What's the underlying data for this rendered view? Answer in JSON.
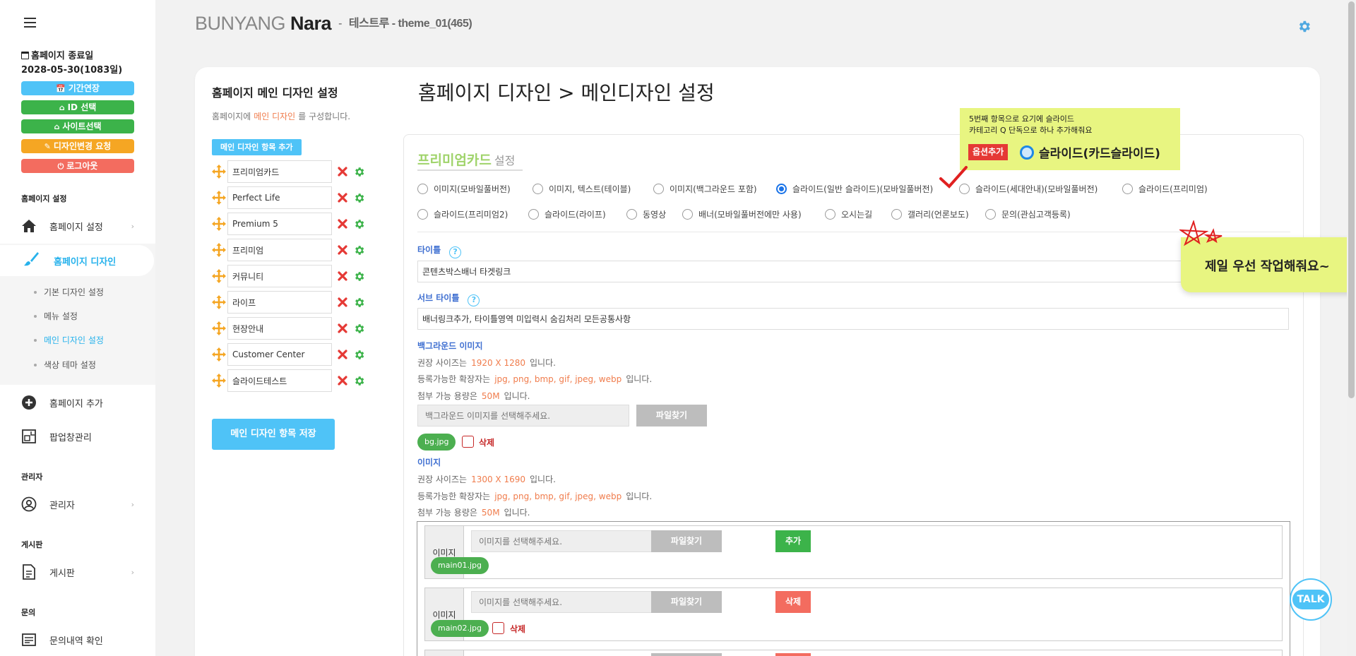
{
  "colors": {
    "accent": "#27b2ec",
    "green": "#4caf50",
    "red": "#e53935",
    "note": "#e8f581"
  },
  "sidebar": {
    "expiry_title": "홈페이지 종료일",
    "expiry_date": "2028-05-30(1083일)",
    "buttons": [
      {
        "label": "기간연장",
        "icon": "calendar-icon",
        "color": "#4fc3f7"
      },
      {
        "label": "ID 선택",
        "icon": "home-icon",
        "color": "#3cb34a"
      },
      {
        "label": "사이트선택",
        "icon": "home-icon",
        "color": "#3cb34a"
      },
      {
        "label": "디자인변경 요청",
        "icon": "brush-icon",
        "color": "#f5a623"
      },
      {
        "label": "로그아웃",
        "icon": "power-icon",
        "color": "#f36c5f"
      }
    ],
    "sections": {
      "homepage_settings": "홈페이지 설정",
      "admin": "관리자",
      "board": "게시판",
      "inquiry": "문의"
    },
    "nav": {
      "homepage_settings": "홈페이지 설정",
      "homepage_design": "홈페이지 디자인",
      "add_homepage": "홈페이지 추가",
      "popup": "팝업창관리",
      "admin": "관리자",
      "board": "게시판",
      "inquiry_check": "문의내역 확인"
    },
    "sub_items": [
      "기본 디자인 설정",
      "메뉴 설정",
      "메인 디자인 설정",
      "색상 테마 설정"
    ],
    "active_sub": "메인 디자인 설정"
  },
  "header": {
    "brand_light": "BUNYANG ",
    "brand_bold": "Nara",
    "separator": "-",
    "project": "테스트루 - theme_01(465)"
  },
  "left_panel": {
    "title": "홈페이지 메인 디자인 설정",
    "desc_prefix": "홈페이지에",
    "desc_highlight": "메인 디자인",
    "desc_suffix": "를 구성합니다.",
    "add_button": "메인 디자인 항목 추가",
    "items": [
      "프리미엄카드",
      "Perfect Life",
      "Premium 5",
      "프리미엄",
      "커뮤니티",
      "라이프",
      "현장안내",
      "Customer Center",
      "슬라이드테스트"
    ],
    "save_button": "메인 디자인 항목 저장"
  },
  "main": {
    "page_title": "홈페이지 디자인 > 메인디자인 설정",
    "section_name": "프리미엄카드",
    "section_suffix": "설정",
    "type_options": [
      "이미지(모바일풀버전)",
      "이미지, 텍스트(테이블)",
      "이미지(백그라운드 포함)",
      "슬라이드(일반 슬라이드)(모바일풀버전)",
      "슬라이드(세대안내)(모바일풀버전)",
      "슬라이드(프리미엄)",
      "슬라이드(프리미엄2)",
      "슬라이드(라이프)",
      "동영상",
      "배너(모바일풀버전에만 사용)",
      "오시는길",
      "갤러리(언론보도)",
      "문의(관심고객등록)"
    ],
    "selected_option": "슬라이드(일반 슬라이드)(모바일풀버전)",
    "title_label": "타이틀",
    "title_value": "콘텐츠박스배너 타겟링크",
    "subtitle_label": "서브 타이틀",
    "subtitle_value": "배너링크추가, 타이틀영역 미입력시 숨김처리 모든공통사항",
    "help_glyph": "?",
    "bg": {
      "label": "백그라운드 이미지",
      "size_prefix": "권장 사이즈는",
      "size": "1920 X 1280",
      "size_suffix": "입니다.",
      "ext_prefix": "등록가능한 확장자는",
      "ext": "jpg, png, bmp, gif, jpeg, webp",
      "ext_suffix": "입니다.",
      "cap_prefix": "첨부 가능 용량은",
      "cap": "50M",
      "cap_suffix": "입니다.",
      "placeholder": "백그라운드 이미지를 선택해주세요.",
      "find_button": "파일찾기",
      "file": "bg.jpg",
      "delete_label": "삭제"
    },
    "image": {
      "label": "이미지",
      "size_prefix": "권장 사이즈는",
      "size": "1300 X 1690",
      "size_suffix": "입니다.",
      "ext_prefix": "등록가능한 확장자는",
      "ext": "jpg, png, bmp, gif, jpeg, webp",
      "ext_suffix": "입니다.",
      "cap_prefix": "첨부 가능 용량은",
      "cap": "50M",
      "cap_suffix": "입니다.",
      "rows": [
        {
          "label": "이미지",
          "placeholder": "이미지를 선택해주세요.",
          "find": "파일찾기",
          "action": "추가",
          "file": "main01.jpg"
        },
        {
          "label": "이미지",
          "placeholder": "이미지를 선택해주세요.",
          "find": "파일찾기",
          "action": "삭제",
          "file": "main02.jpg",
          "delete_label": "삭제"
        }
      ]
    }
  },
  "notes": {
    "note1_line1": "5번째 항목으로 요기에 슬라이드",
    "note1_line2": "카테고리 Q 단독으로 하나 추가해줘요",
    "note1_badge": "옵션추가",
    "note1_option": "슬라이드(카드슬라이드)",
    "note2": "제일 우선 작업해줘요~"
  },
  "talk_label": "TALK"
}
